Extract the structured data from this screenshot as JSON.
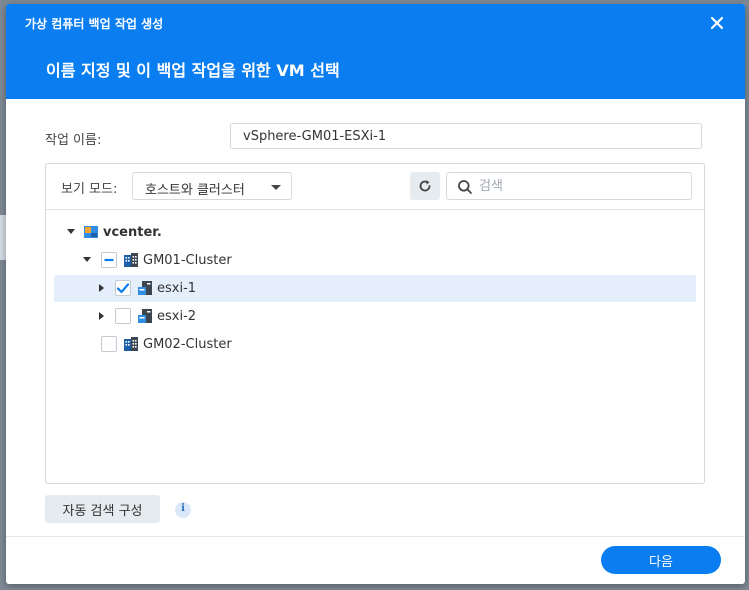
{
  "dialog": {
    "window_title": "가상 컴퓨터 백업 작업 생성",
    "step_title": "이름 지정 및 이 백업 작업을 위한 VM 선택"
  },
  "form": {
    "task_name_label": "작업 이름:",
    "task_name_value": "vSphere-GM01-ESXi-1"
  },
  "toolbar": {
    "view_mode_label": "보기 모드:",
    "view_mode_selected": "호스트와 클러스터",
    "search_placeholder": "검색"
  },
  "tree": {
    "nodes": [
      {
        "label": "vcenter.",
        "level": 0,
        "expanded": true,
        "checkbox": "none",
        "icon": "vcenter-icon"
      },
      {
        "label": "GM01-Cluster",
        "level": 1,
        "expanded": true,
        "checkbox": "indeterminate",
        "icon": "cluster-icon"
      },
      {
        "label": "esxi-1",
        "level": 2,
        "expanded": false,
        "checkbox": "checked",
        "icon": "host-icon",
        "selected": true
      },
      {
        "label": "esxi-2",
        "level": 2,
        "expanded": false,
        "checkbox": "unchecked",
        "icon": "host-icon"
      },
      {
        "label": "GM02-Cluster",
        "level": 1,
        "expanded": null,
        "checkbox": "unchecked",
        "icon": "cluster-icon"
      }
    ]
  },
  "footer": {
    "autodetect_button": "자동 검색 구성",
    "next_button": "다음"
  },
  "colors": {
    "accent": "#0a7ef0",
    "selected_row": "#e5eefb",
    "button_gray": "#e6ebf0"
  }
}
